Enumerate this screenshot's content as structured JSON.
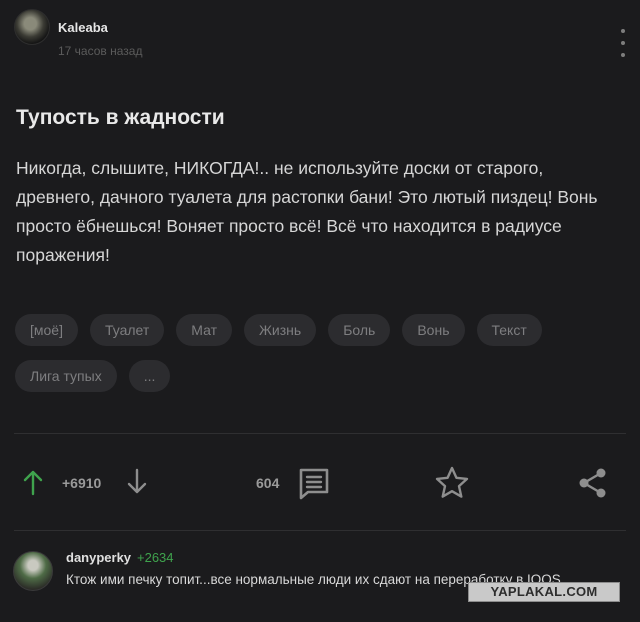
{
  "post": {
    "author": "Kaleaba",
    "time": "17 часов назад",
    "title": "Тупость в жадности",
    "body": "Никогда, слышите, НИКОГДА!.. не используйте доски от старого, древнего, дачного туалета для растопки бани! Это лютый пиздец! Вонь просто ёбнешься! Воняет просто всё! Всё что находится в радиусе поражения!",
    "tags": [
      "[моё]",
      "Туалет",
      "Мат",
      "Жизнь",
      "Боль",
      "Вонь",
      "Текст",
      "Лига тупых",
      "..."
    ]
  },
  "actions": {
    "rating": "+6910",
    "comments_count": "604"
  },
  "comment": {
    "user": "danyperky",
    "rating": "+2634",
    "text": "Ктож ими печку топит...все нормальные люди их сдают на переработку в IQOS"
  },
  "watermark": "YAPLAKAL.COM",
  "colors": {
    "background": "#1b1b1d",
    "tag_background": "#2c2c2f",
    "upvote_green": "#3fa34d",
    "icon_gray": "#8e8e8e"
  },
  "icons": [
    "avatar",
    "more-vertical-icon",
    "arrow-up-icon",
    "arrow-down-icon",
    "comment-icon",
    "star-icon",
    "share-icon"
  ]
}
